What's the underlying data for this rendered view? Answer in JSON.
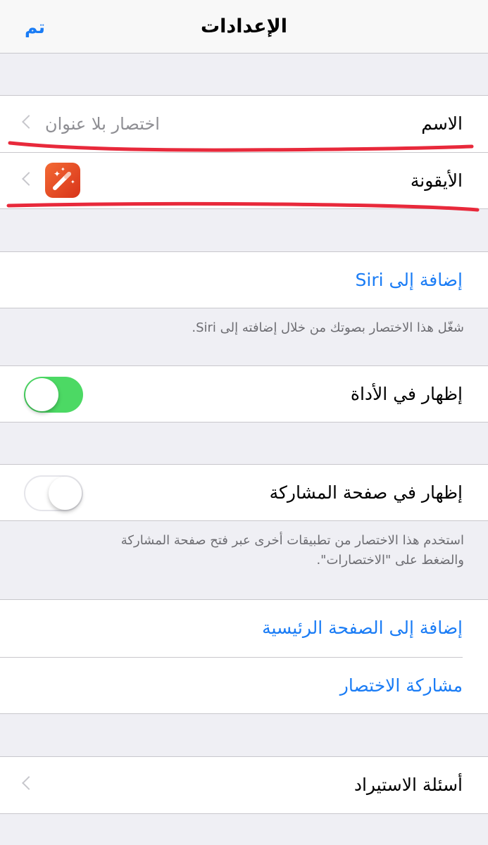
{
  "navbar": {
    "title": "الإعدادات",
    "done_label": "تم"
  },
  "info_group": {
    "name_label": "الاسم",
    "name_value": "اختصار بلا عنوان",
    "icon_label": "الأيقونة"
  },
  "siri": {
    "add_label": "إضافة إلى Siri",
    "footer": "شغّل هذا الاختصار بصوتك من خلال إضافته إلى Siri."
  },
  "widget": {
    "label": "إظهار في الأداة",
    "enabled": true
  },
  "share_sheet": {
    "label": "إظهار في صفحة المشاركة",
    "enabled": false,
    "footer_line1": "استخدم هذا الاختصار من تطبيقات أخرى عبر فتح صفحة المشاركة",
    "footer_line2": "والضغط على \"الاختصارات\"."
  },
  "actions": {
    "add_home_label": "إضافة إلى الصفحة الرئيسية",
    "share_label": "مشاركة الاختصار"
  },
  "import": {
    "label": "أسئلة الاستيراد"
  },
  "colors": {
    "accent": "#1a7cf5",
    "toggle_on": "#4cd964",
    "annotation": "#e8293b"
  }
}
